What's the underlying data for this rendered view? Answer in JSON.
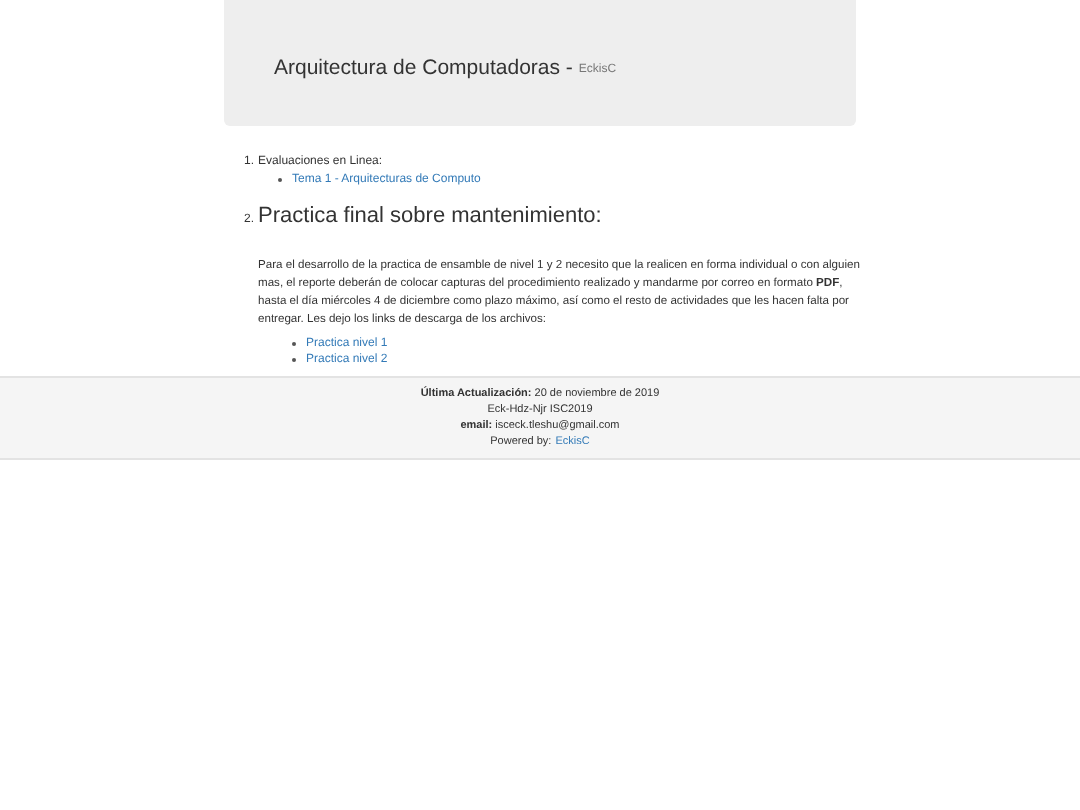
{
  "header": {
    "title": "Arquitectura de Computadoras -",
    "subtitle": "EckisC"
  },
  "sections": [
    {
      "number": "1.",
      "kind": "small",
      "title": "Evaluaciones en Linea:",
      "links": [
        "Tema 1 - Arquitecturas de Computo"
      ]
    },
    {
      "number": "2.",
      "kind": "heading",
      "title": "Practica final sobre mantenimiento:",
      "paragraph": "Para el desarrollo de la practica de ensamble de nivel 1 y 2 necesito que la realicen en forma individual o con alguien mas, el reporte deberán de colocar capturas del procedimiento realizado y mandarme por correo en formato **PDF**, hasta el día miércoles 4 de diciembre como plazo máximo, así como el resto de actividades que les hacen falta por entregar. Les dejo los links de descarga de los archivos:",
      "links": [
        "Practica nivel 1",
        "Practica nivel 2"
      ]
    }
  ],
  "footer": {
    "lines": [
      "**Última Actualización:** 20 de noviembre de 2019",
      "Eck-Hdz-Njr ISC2019",
      "**email:** isceck.tleshu@gmail.com"
    ],
    "powered_label": "Powered by:",
    "powered_link": "EckisC"
  }
}
